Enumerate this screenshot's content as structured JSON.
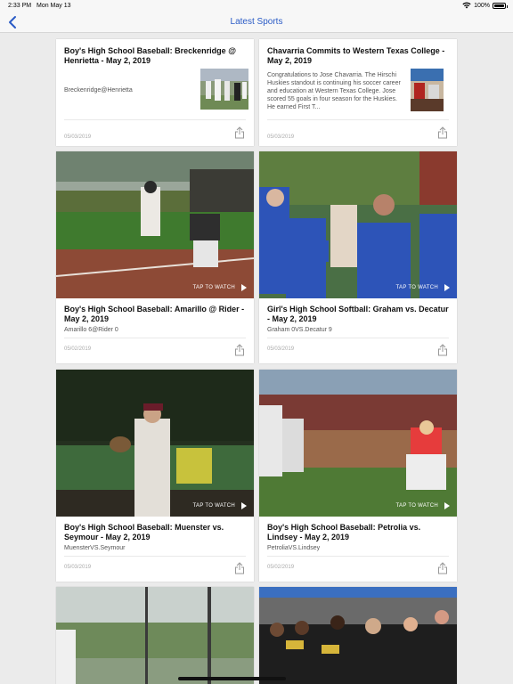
{
  "status_bar": {
    "time": "2:33 PM",
    "date": "Mon May 13",
    "battery": "100%"
  },
  "nav": {
    "title": "Latest Sports"
  },
  "cards": [
    {
      "title": "Boy's High School Baseball: Breckenridge @ Henrietta - May 2, 2019",
      "subtitle": "Breckenridge@Henrietta",
      "date": "05/03/2019"
    },
    {
      "title": "Chavarria Commits to Western Texas College - May 2, 2019",
      "subtitle": "Congratulations to Jose Chavarria. The Hirschi Huskies standout is continuing his soccer career and education at Western Texas College. Jose scored 55 goals in four season for the Huskies. He earned First T...",
      "date": "05/03/2019"
    },
    {
      "title": "Boy's High School Baseball: Amarillo @ Rider - May 2, 2019",
      "subtitle": "Amarillo 6@Rider 0",
      "date": "05/02/2019",
      "tap_label": "TAP TO WATCH"
    },
    {
      "title": "Girl's High School Softball: Graham vs. Decatur - May 2, 2019",
      "subtitle": "Graham 0VS.Decatur 9",
      "date": "05/03/2019",
      "tap_label": "TAP TO WATCH"
    },
    {
      "title": "Boy's High School Baseball: Muenster vs. Seymour - May 2, 2019",
      "subtitle": "MuensterVS.Seymour",
      "date": "05/03/2019",
      "tap_label": "TAP TO WATCH"
    },
    {
      "title": "Boy's High School Baseball: Petrolia vs. Lindsey - May 2, 2019",
      "subtitle": "PetroliaVS.Lindsey",
      "date": "05/02/2019",
      "tap_label": "TAP TO WATCH"
    }
  ],
  "colors": {
    "accent": "#2a5bc6"
  }
}
